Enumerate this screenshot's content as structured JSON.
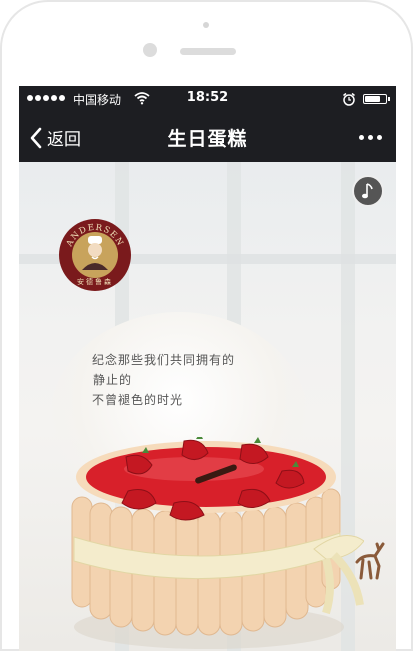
{
  "status_bar": {
    "carrier": "中国移动",
    "time": "18:52"
  },
  "nav": {
    "back_label": "返回",
    "title": "生日蛋糕"
  },
  "banner": {
    "brand_logo_text": "ANDERSEN",
    "brand_logo_cn": "安德鲁森",
    "slogan": [
      "纪念那些我们共同拥有的",
      "静止的",
      "不曾褪色的时光"
    ]
  },
  "colors": {
    "bar_bg": "#1d1e22",
    "logo_red": "#7a1a1c",
    "logo_gold": "#c8a35c",
    "glaze_red": "#d8202a",
    "ribbon": "#f4eccc"
  }
}
